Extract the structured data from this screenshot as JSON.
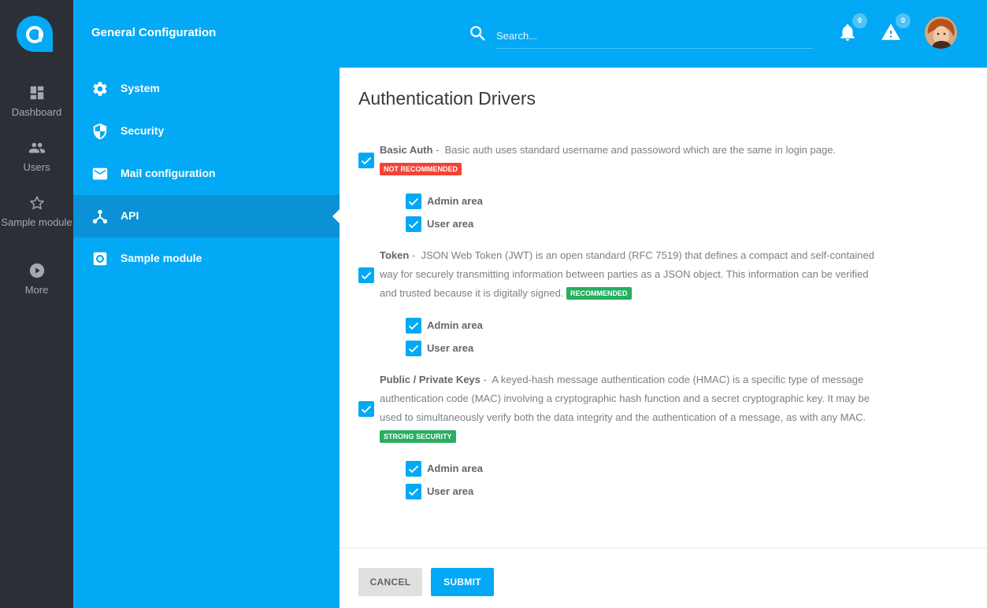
{
  "app": {
    "title": "General Configuration"
  },
  "rail": {
    "items": [
      {
        "label": "Dashboard",
        "icon": "dashboard-icon"
      },
      {
        "label": "Users",
        "icon": "users-icon"
      },
      {
        "label": "Sample module",
        "icon": "star-icon"
      },
      {
        "label": "More",
        "icon": "play-circle-icon"
      }
    ]
  },
  "header": {
    "search_placeholder": "Search...",
    "notifications_count": "0",
    "alerts_count": "0"
  },
  "subnav": {
    "items": [
      {
        "label": "System",
        "icon": "gear-icon"
      },
      {
        "label": "Security",
        "icon": "shield-icon"
      },
      {
        "label": "Mail configuration",
        "icon": "mail-icon"
      },
      {
        "label": "API",
        "icon": "api-icon",
        "active": true
      },
      {
        "label": "Sample module",
        "icon": "module-gear-icon"
      }
    ]
  },
  "main": {
    "title": "Authentication Drivers",
    "drivers": [
      {
        "name": "Basic Auth",
        "description": "Basic auth uses standard username and passoword which are the same in login page.",
        "tag": "NOT RECOMMENDED",
        "checked": true,
        "options": [
          {
            "label": "Admin area",
            "checked": true
          },
          {
            "label": "User area",
            "checked": true
          }
        ]
      },
      {
        "name": "Token",
        "description": "JSON Web Token (JWT) is an open standard (RFC 7519) that defines a compact and self-contained way for securely transmitting information between parties as a JSON object. This information can be verified and trusted because it is digitally signed.",
        "tag": "RECOMMENDED",
        "checked": true,
        "options": [
          {
            "label": "Admin area",
            "checked": true
          },
          {
            "label": "User area",
            "checked": true
          }
        ]
      },
      {
        "name": "Public / Private Keys",
        "description": "A keyed-hash message authentication code (HMAC) is a specific type of message authentication code (MAC) involving a cryptographic hash function and a secret cryptographic key. It may be used to simultaneously verify both the data integrity and the authentication of a message, as with any MAC.",
        "tag": "STRONG SECURITY",
        "checked": true,
        "options": [
          {
            "label": "Admin area",
            "checked": true
          },
          {
            "label": "User area",
            "checked": true
          }
        ]
      }
    ],
    "cancel_label": "CANCEL",
    "submit_label": "SUBMIT"
  },
  "colors": {
    "primary": "#03a9f4",
    "rail": "#2c2f36",
    "active_nav": "#0a91d6",
    "tag_red": "#f44336",
    "tag_green": "#27ae60"
  }
}
